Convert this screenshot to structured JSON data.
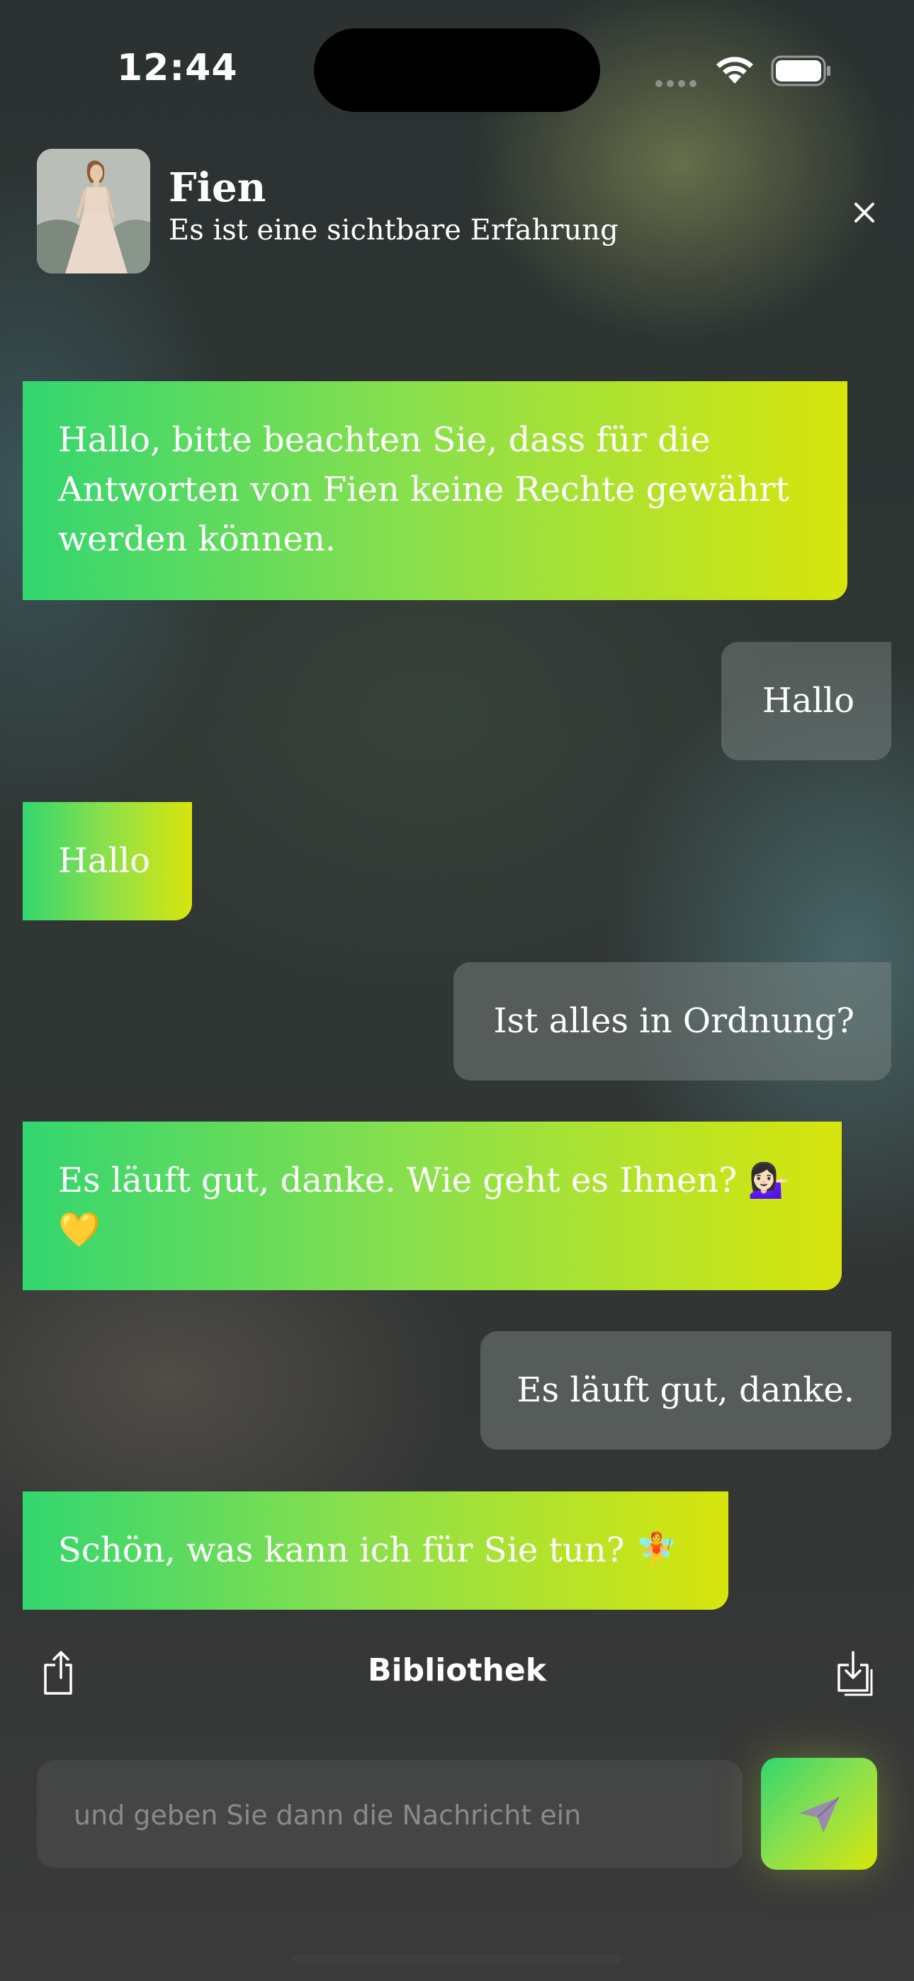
{
  "status": {
    "time": "12:44"
  },
  "header": {
    "name": "Fien",
    "subtitle": "Es ist eine sichtbare Erfahrung",
    "close_icon": "close-icon"
  },
  "messages": [
    {
      "role": "bot",
      "text": "Hallo, bitte beachten Sie, dass für die Antworten von Fien keine Rechte gewährt werden können."
    },
    {
      "role": "user",
      "text": "Hallo"
    },
    {
      "role": "bot",
      "text": "Hallo"
    },
    {
      "role": "user",
      "text": "Ist alles in Ordnung?"
    },
    {
      "role": "bot",
      "text": "Es läuft gut, danke. Wie geht es Ihnen? 💁🏻‍♀️ 💛"
    },
    {
      "role": "user",
      "text": "Es läuft gut, danke."
    },
    {
      "role": "bot",
      "text": "Schön, was kann ich für Sie tun? 🧚"
    }
  ],
  "toolbar": {
    "title": "Bibliothek",
    "left_icon": "share-icon",
    "right_icon": "download-icon"
  },
  "composer": {
    "placeholder": "und geben Sie dann die Nachricht ein",
    "send_icon": "send-icon"
  },
  "colors": {
    "bot_gradient_start": "#33d670",
    "bot_gradient_end": "#d8e50c"
  }
}
